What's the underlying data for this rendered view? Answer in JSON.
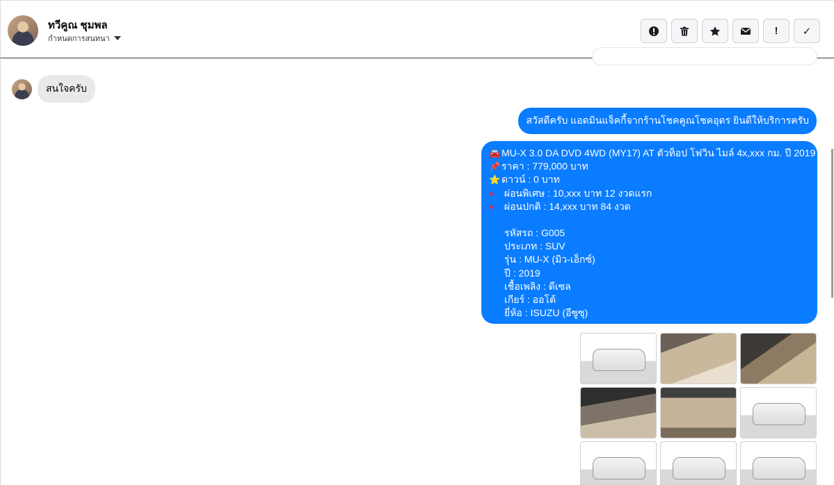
{
  "header": {
    "contact_name": "ทวีคูณ ชุมพล",
    "subtitle": "กำหนดการสนทนา",
    "toolbar": [
      {
        "name": "report-button",
        "icon": "exclamation-circle-icon"
      },
      {
        "name": "delete-button",
        "icon": "trash-icon"
      },
      {
        "name": "star-button",
        "icon": "star-icon"
      },
      {
        "name": "mark-unread-button",
        "icon": "envelope-icon"
      },
      {
        "name": "important-button",
        "icon": "exclamation-icon",
        "label": "!"
      },
      {
        "name": "done-button",
        "icon": "check-icon",
        "label": "✓"
      }
    ]
  },
  "messages": {
    "incoming_1": "สนใจครับ",
    "outgoing_1": "สวัสดีครับ แอดมินแจ็คกี้จากร้านโชคคูณโชคอุดร ยินดีให้บริการครับ",
    "outgoing_2": {
      "title": "MU-X 3.0 DA DVD 4WD (MY17) AT ตัวท็อป โฟวิน ไมล์ 4x,xxx กม. ปี 2019",
      "price": "ราคา : 779,000 บาท",
      "down": "ดาวน์ : 0 บาท",
      "special": "ผ่อนพิเศษ : 10,xxx บาท 12 งวดแรก",
      "normal": "ผ่อนปกติ : 14,xxx บาท 84 งวด",
      "code": "รหัสรถ : G005",
      "type": "ประเภท : SUV",
      "model": "รุ่น : MU-X (มิว-เอ็กซ์)",
      "year": "ปี : 2019",
      "fuel": "เชื้อเพลิง : ดีเซล",
      "gear": "เกียร์ : ออโต้",
      "brand": "ยี่ห้อ : ISUZU (อีซูซุ)"
    },
    "emoji": {
      "car": "🚘",
      "pin": "📌",
      "star": "⭐",
      "diamond": "♦"
    }
  },
  "photos": [
    "car-exterior-front-photo",
    "car-door-interior-photo",
    "car-gear-shifter-photo",
    "car-dashboard-photo",
    "car-front-seats-photo",
    "car-exterior-rear-photo",
    "car-exterior-front-2-photo",
    "car-exterior-rear-2-photo",
    "car-exterior-side-photo"
  ],
  "colors": {
    "outgoing_bubble": "#0a7cff",
    "incoming_bubble": "#e9e9eb"
  }
}
